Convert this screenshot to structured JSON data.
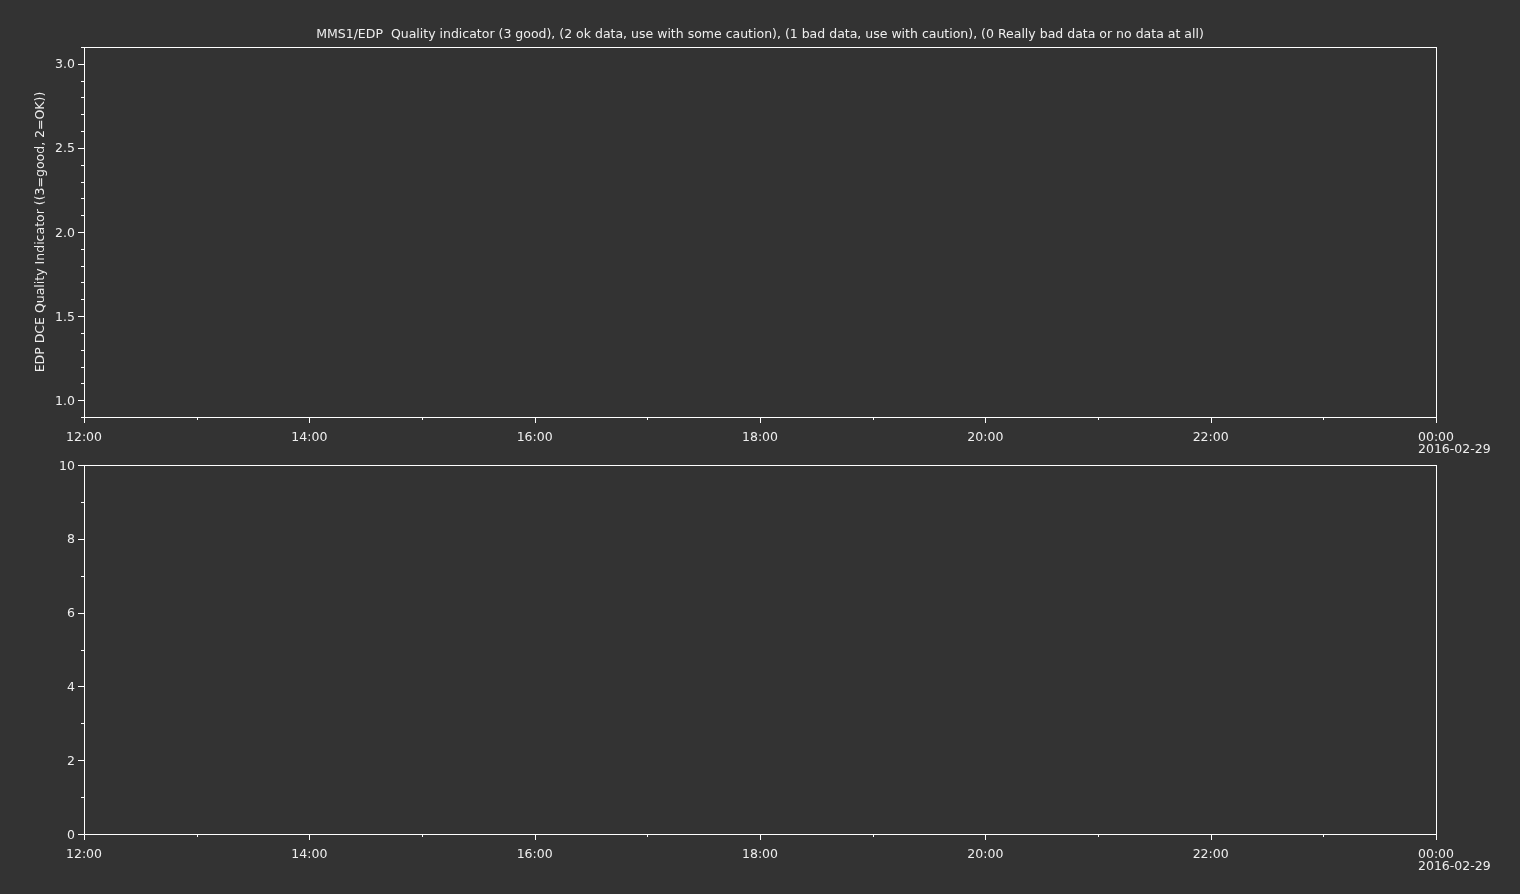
{
  "panels": [
    {
      "chart_data": {
        "type": "line",
        "title": "MMS1/EDP  Quality indicator (3 good), (2 ok data, use with some caution), (1 bad data, use with caution), (0 Really bad data or no data at all)",
        "ylabel": "EDP DCE Quality Indicator ((3=good, 2=OK))",
        "xlim": [
          12,
          24
        ],
        "ylim": [
          0.9,
          3.1
        ],
        "xticks": [
          {
            "value": 12,
            "label": "12:00"
          },
          {
            "value": 14,
            "label": "14:00"
          },
          {
            "value": 16,
            "label": "16:00"
          },
          {
            "value": 18,
            "label": "18:00"
          },
          {
            "value": 20,
            "label": "20:00"
          },
          {
            "value": 22,
            "label": "22:00"
          },
          {
            "value": 24,
            "label": "00:00"
          }
        ],
        "yticks": [
          {
            "value": 1,
            "label": "1.0"
          },
          {
            "value": 1.5,
            "label": "1.5"
          },
          {
            "value": 2,
            "label": "2.0"
          },
          {
            "value": 2.5,
            "label": "2.5"
          },
          {
            "value": 3,
            "label": "3.0"
          }
        ]
      },
      "date_label": "2016-02-29"
    },
    {
      "chart_data": {
        "type": "line",
        "xlim": [
          12,
          24
        ],
        "ylim": [
          0,
          10
        ],
        "xticks": [
          {
            "value": 12,
            "label": "12:00"
          },
          {
            "value": 14,
            "label": "14:00"
          },
          {
            "value": 16,
            "label": "16:00"
          },
          {
            "value": 18,
            "label": "18:00"
          },
          {
            "value": 20,
            "label": "20:00"
          },
          {
            "value": 22,
            "label": "22:00"
          },
          {
            "value": 24,
            "label": "00:00"
          }
        ],
        "yticks": [
          {
            "value": 0,
            "label": "0"
          },
          {
            "value": 2,
            "label": "2"
          },
          {
            "value": 4,
            "label": "4"
          },
          {
            "value": 6,
            "label": "6"
          },
          {
            "value": 8,
            "label": "8"
          },
          {
            "value": 10,
            "label": "10"
          }
        ]
      },
      "date_label": "2016-02-29"
    }
  ]
}
